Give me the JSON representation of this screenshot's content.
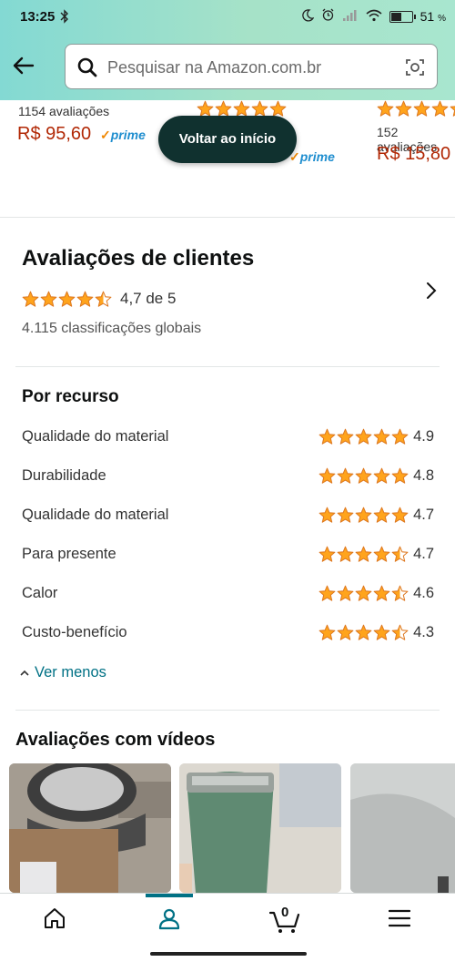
{
  "status_bar": {
    "time": "13:25",
    "battery": "51",
    "battery_unit": "%",
    "battery_level": 0.51
  },
  "search": {
    "placeholder": "Pesquisar na Amazon.com.br"
  },
  "recommendations": [
    {
      "review_count": "1154 avaliações",
      "price": "R$ 95,60",
      "prime": "prime"
    },
    {
      "price": "R$ 15,80",
      "review_count": "152 avaliações",
      "prime": "prime"
    }
  ],
  "back_to_top": "Voltar ao início",
  "reviews": {
    "title": "Avaliações de clientes",
    "rating_text": "4,7 de 5",
    "rating_value": 4.7,
    "global_count": "4.115 classificações globais"
  },
  "features": {
    "title": "Por recurso",
    "items": [
      {
        "name": "Qualidade do material",
        "value": "4.9"
      },
      {
        "name": "Durabilidade",
        "value": "4.8"
      },
      {
        "name": "Qualidade do material",
        "value": "4.7"
      },
      {
        "name": "Para presente",
        "value": "4.7"
      },
      {
        "name": "Calor",
        "value": "4.6"
      },
      {
        "name": "Custo-benefício",
        "value": "4.3"
      }
    ],
    "toggle_label": "Ver menos"
  },
  "videos": {
    "title": "Avaliações com vídeos"
  },
  "bottom_nav": {
    "cart_count": "0",
    "active": "account"
  },
  "colors": {
    "star": "#ffa41c",
    "link": "#007185",
    "price": "#b12704",
    "header_start": "#83d9d3",
    "header_end": "#a8e6cf"
  },
  "icons": [
    "back-arrow-icon",
    "search-icon",
    "camera-icon",
    "home-icon",
    "account-icon",
    "cart-icon",
    "menu-icon",
    "chevron-right-icon"
  ]
}
